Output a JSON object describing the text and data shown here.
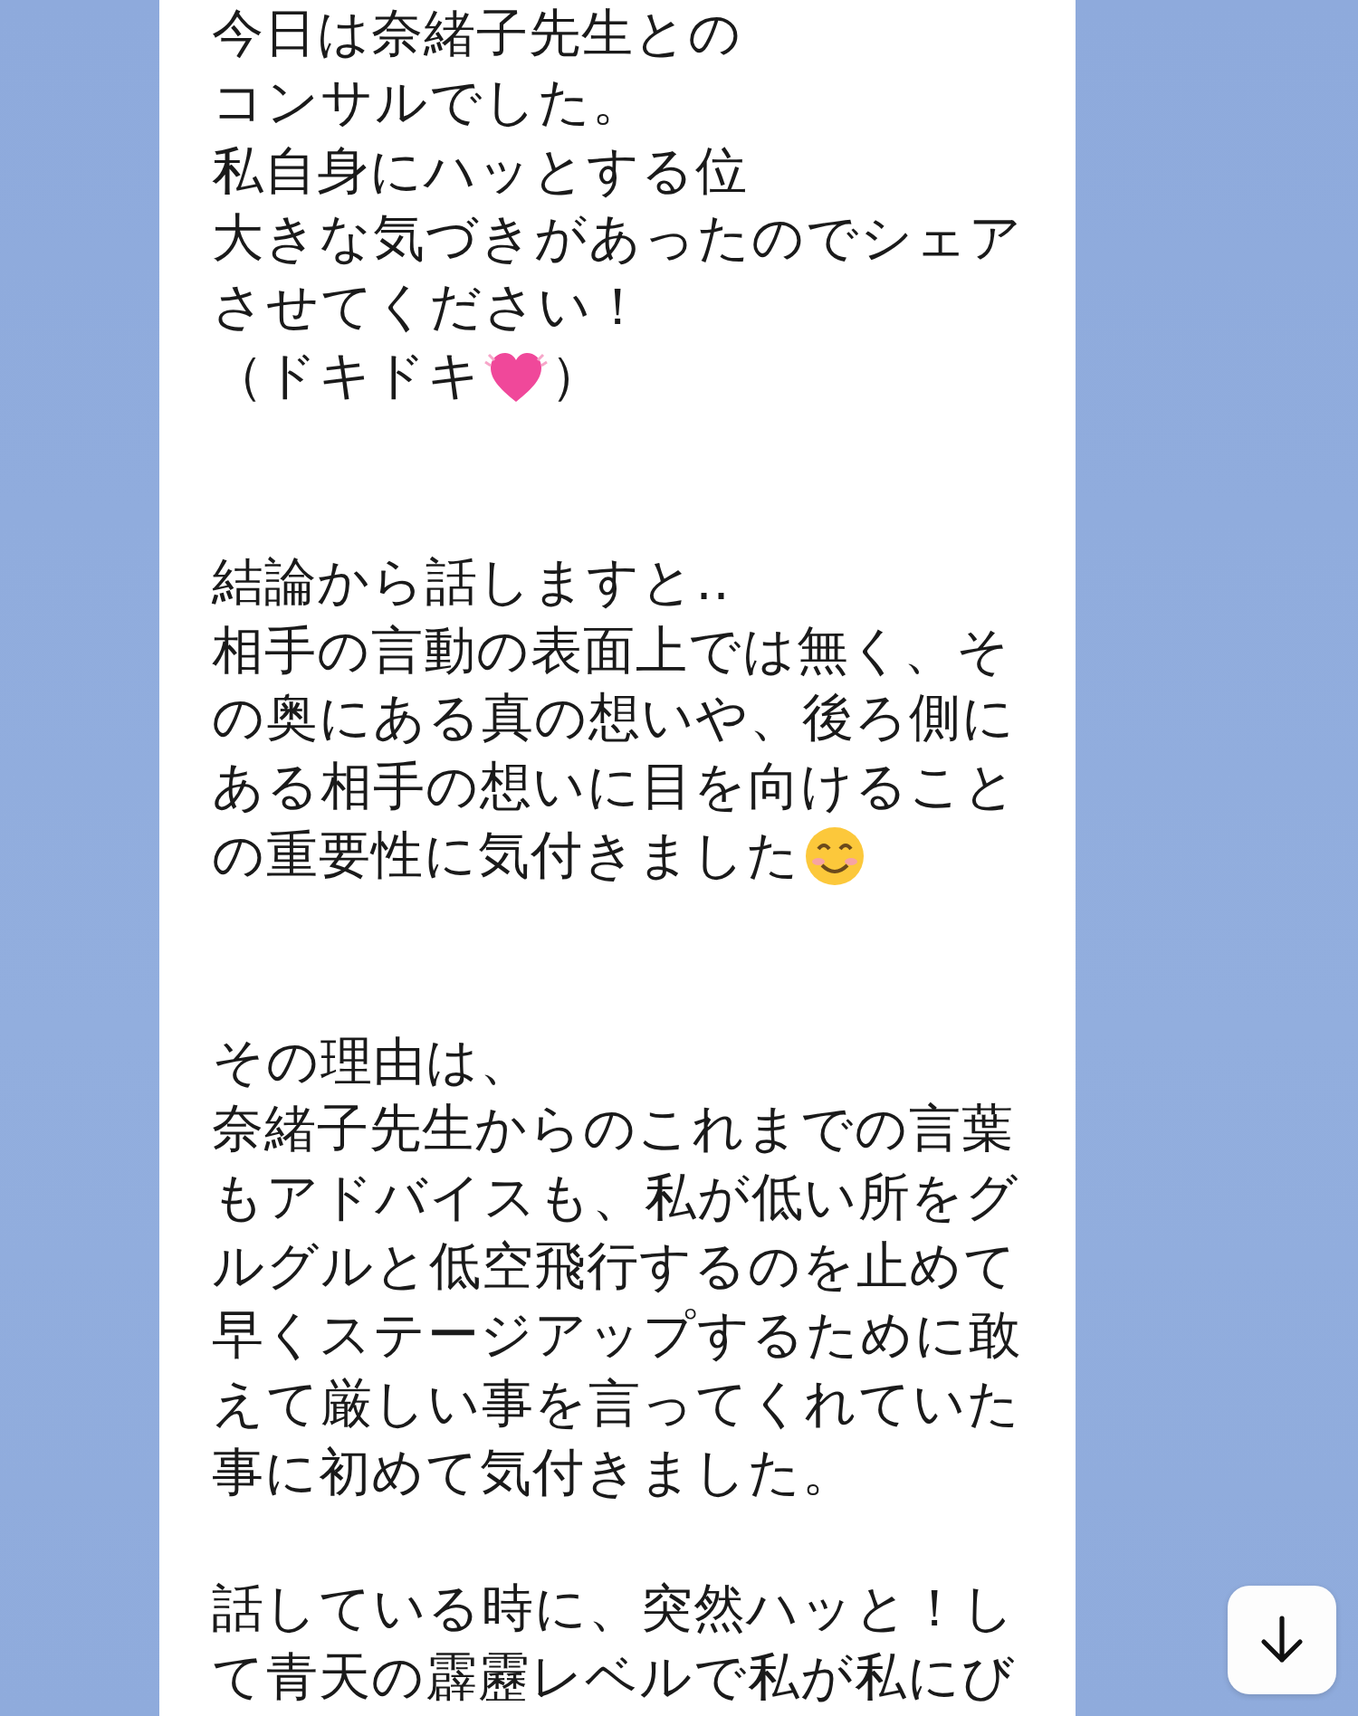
{
  "message": {
    "lines": [
      {
        "kind": "text",
        "text": "今日は奈緒子先生との"
      },
      {
        "kind": "text",
        "text": "コンサルでした。"
      },
      {
        "kind": "text",
        "text": "私自身にハッとする位"
      },
      {
        "kind": "text",
        "text": "大きな気づきがあったのでシェア"
      },
      {
        "kind": "text",
        "text": "させてください！"
      },
      {
        "kind": "heart_line",
        "text": "（ドキドキ",
        "after": "）"
      },
      {
        "kind": "blank"
      },
      {
        "kind": "blank"
      },
      {
        "kind": "text",
        "text": "結論から話しますと‥"
      },
      {
        "kind": "text",
        "text": "相手の言動の表面上では無く、そ"
      },
      {
        "kind": "text",
        "text": "の奥にある真の想いや、後ろ側に"
      },
      {
        "kind": "text",
        "text": "ある相手の想いに目を向けること"
      },
      {
        "kind": "smile_line",
        "text": "の重要性に気付きました"
      },
      {
        "kind": "blank"
      },
      {
        "kind": "blank"
      },
      {
        "kind": "text",
        "text": "その理由は、"
      },
      {
        "kind": "text",
        "text": "奈緒子先生からのこれまでの言葉"
      },
      {
        "kind": "text",
        "text": "もアドバイスも、私が低い所をグ"
      },
      {
        "kind": "text",
        "text": "ルグルと低空飛行するのを止めて"
      },
      {
        "kind": "text",
        "text": "早くステージアップするために敢"
      },
      {
        "kind": "text",
        "text": "えて厳しい事を言ってくれていた"
      },
      {
        "kind": "text",
        "text": "事に初めて気付きました。"
      },
      {
        "kind": "blank"
      },
      {
        "kind": "text",
        "text": "話している時に、突然ハッと！し"
      },
      {
        "kind": "text",
        "text": "て青天の霹靂レベルで私が私にび"
      }
    ]
  },
  "scroll_down_button": {
    "kind": "arrow"
  }
}
